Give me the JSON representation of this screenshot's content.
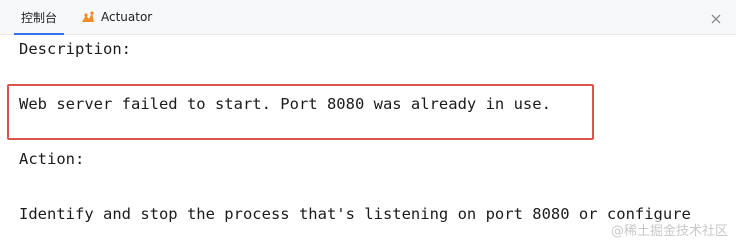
{
  "tabs": [
    {
      "label": "控制台",
      "active": true
    },
    {
      "label": "Actuator",
      "active": false,
      "icon": "actuator-icon"
    }
  ],
  "console": {
    "lines": [
      "Description:",
      "Web server failed to start. Port 8080 was already in use.",
      "Action:",
      "Identify and stop the process that's listening on port 8080 or configure"
    ]
  },
  "highlight_color": "#d9534f",
  "accent_color": "#3574f0",
  "watermark": "@稀土掘金技术社区"
}
